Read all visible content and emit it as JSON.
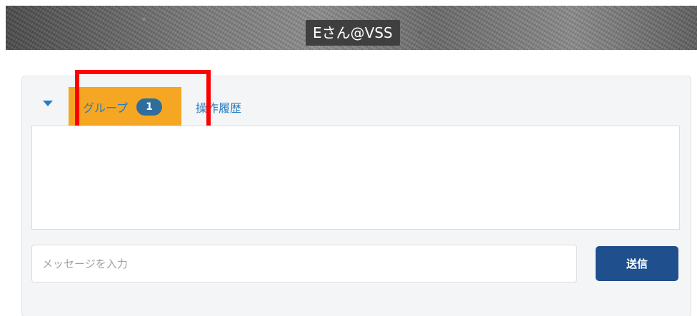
{
  "header": {
    "title": "Eさん@VSS"
  },
  "tabs": {
    "group": {
      "label": "グループ",
      "count": "1"
    },
    "history": {
      "label": "操作履歴"
    }
  },
  "composer": {
    "placeholder": "メッセージを入力",
    "value": "",
    "send_label": "送信"
  },
  "colors": {
    "active_tab": "#f5a623",
    "link": "#2a7bbf",
    "badge": "#2d6e9c",
    "send_button": "#1f4f8c",
    "highlight": "#ff0000"
  },
  "icons": {
    "collapse": "caret-down-icon"
  }
}
